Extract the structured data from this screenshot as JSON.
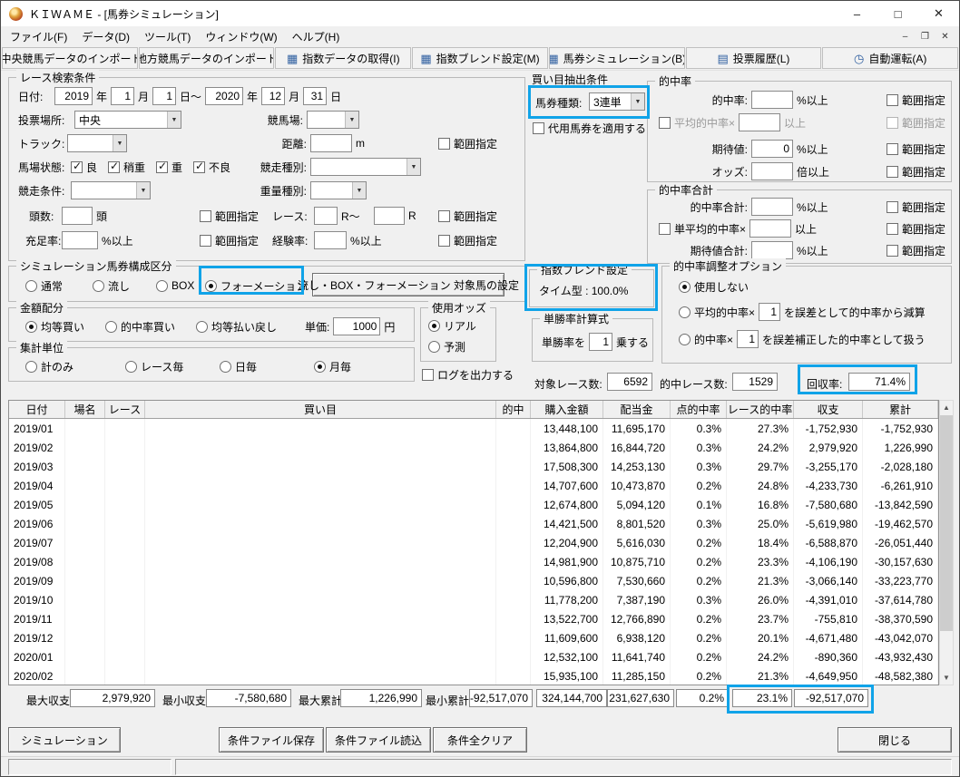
{
  "colors": {
    "accent": "#10a3e8"
  },
  "labels": {
    "range": "範囲指定"
  },
  "icons": {
    "minimize-icon": "–",
    "maximize-icon": "□",
    "close-icon": "✕",
    "mdi-minimize-icon": "–",
    "mdi-restore-icon": "❐",
    "mdi-close-icon": "✕",
    "dropdown-arrow-icon": "▼",
    "scroll-up-icon": "▲",
    "scroll-down-icon": "▼",
    "table-icon": "▦",
    "list-icon": "▤",
    "clock-icon": "◷"
  },
  "window": {
    "title": "ＫＩＷＡＭＥ - [馬券シミュレーション]",
    "controls": {
      "minimize": "–",
      "maximize": "□",
      "close": "✕"
    }
  },
  "menu": {
    "items": [
      "ファイル(F)",
      "データ(D)",
      "ツール(T)",
      "ウィンドウ(W)",
      "ヘルプ(H)"
    ]
  },
  "toolbar": {
    "buttons": [
      {
        "label": "中央競馬データのインポート(J)",
        "icon": "table-icon"
      },
      {
        "label": "地方競馬データのインポート(N)",
        "icon": "table-icon"
      },
      {
        "label": "指数データの取得(I)",
        "icon": "table-icon"
      },
      {
        "label": "指数ブレンド設定(M)",
        "icon": "table-icon"
      },
      {
        "label": "馬券シミュレーション(B)",
        "icon": "table-icon"
      },
      {
        "label": "投票履歴(L)",
        "icon": "list-icon"
      },
      {
        "label": "自動運転(A)",
        "icon": "clock-icon"
      }
    ]
  },
  "search": {
    "title": "レース検索条件",
    "date": {
      "label": "日付:",
      "y1": "2019",
      "u_year": "年",
      "m1": "1",
      "u_month": "月",
      "d1": "1",
      "u_day_to": "日～",
      "y2": "2020",
      "m2": "12",
      "d2": "31",
      "u_day": "日"
    },
    "place": {
      "label": "投票場所:",
      "value": "中央"
    },
    "course": {
      "label": "競馬場:",
      "value": ""
    },
    "track": {
      "label": "トラック:",
      "value": ""
    },
    "distance": {
      "label": "距離:",
      "value": "",
      "unit": "m"
    },
    "state": {
      "label": "馬場状態:",
      "options": [
        "良",
        "稍重",
        "重",
        "不良"
      ],
      "checked": [
        true,
        true,
        true,
        true
      ]
    },
    "race_kind": {
      "label": "競走種別:",
      "value": ""
    },
    "race_cond": {
      "label": "競走条件:",
      "value": ""
    },
    "weight_kind": {
      "label": "重量種別:",
      "value": ""
    },
    "heads": {
      "label": "頭数:",
      "value": "",
      "unit": "頭"
    },
    "race_no": {
      "label": "レース:",
      "v1": "",
      "sep": "R～",
      "v2": "",
      "unit": "R"
    },
    "fill_rate": {
      "label": "充足率:",
      "value": "",
      "unit": "%以上"
    },
    "exp_rate": {
      "label": "経験率:",
      "value": "",
      "unit": "%以上"
    }
  },
  "sim_type": {
    "title": "シミュレーション馬券構成区分",
    "options": [
      "通常",
      "流し",
      "BOX",
      "フォーメーション"
    ],
    "selected": "フォーメーション",
    "target_button": "流し・BOX・フォーメーション 対象馬の設定"
  },
  "amount": {
    "title": "金額配分",
    "options": [
      "均等買い",
      "的中率買い",
      "均等払い戻し"
    ],
    "selected": "均等買い",
    "unit_label": "単価:",
    "unit_value": "1000",
    "unit_suffix": "円"
  },
  "odds_used": {
    "title": "使用オッズ",
    "options": [
      "リアル",
      "予測"
    ],
    "selected": "リアル"
  },
  "aggregate": {
    "title": "集計単位",
    "options": [
      "計のみ",
      "レース毎",
      "日毎",
      "月毎"
    ],
    "selected": "月毎"
  },
  "log_label": "ログを出力する",
  "extract": {
    "title": "買い目抽出条件",
    "ticket": {
      "label": "馬券種類:",
      "value": "3連単"
    },
    "substitute": "代用馬券を適用する",
    "hit": {
      "title": "的中率",
      "rows": [
        {
          "label": "的中率:",
          "value": "",
          "unit": "%以上"
        },
        {
          "label": "平均的中率×",
          "value": "",
          "unit": "以上"
        },
        {
          "label": "期待値:",
          "value": "0",
          "unit": "%以上"
        },
        {
          "label": "オッズ:",
          "value": "",
          "unit": "倍以上"
        }
      ]
    },
    "hit_total": {
      "title": "的中率合計",
      "rows": [
        {
          "label": "的中率合計:",
          "value": "",
          "unit": "%以上"
        },
        {
          "label": "単平均的中率×",
          "value": "",
          "unit": "以上"
        },
        {
          "label": "期待値合計:",
          "value": "",
          "unit": "%以上"
        }
      ]
    }
  },
  "blend": {
    "title": "指数ブレンド設定",
    "value": "タイム型 : 100.0%"
  },
  "win_rate": {
    "title": "単勝率計算式",
    "prefix": "単勝率を",
    "value": "1",
    "suffix": "乗する"
  },
  "adjust": {
    "title": "的中率調整オプション",
    "opt1": "使用しない",
    "opt2_pre": "平均的中率×",
    "opt2_val": "1",
    "opt2_post": "を誤差として的中率から減算",
    "opt3_pre": "的中率×",
    "opt3_val": "1",
    "opt3_post": "を誤差補正した的中率として扱う",
    "selected": "使用しない"
  },
  "stats": {
    "target_label": "対象レース数:",
    "target_value": "6592",
    "hit_label": "的中レース数:",
    "hit_value": "1529",
    "payback_label": "回収率:",
    "payback_value": "71.4%"
  },
  "table": {
    "columns": [
      "日付",
      "場名",
      "レース",
      "買い目",
      "的中",
      "購入金額",
      "配当金",
      "点的中率",
      "レース的中率",
      "収支",
      "累計"
    ],
    "rows": [
      [
        "2019/01",
        "",
        "",
        "",
        "",
        "13,448,100",
        "11,695,170",
        "0.3%",
        "27.3%",
        "-1,752,930",
        "-1,752,930"
      ],
      [
        "2019/02",
        "",
        "",
        "",
        "",
        "13,864,800",
        "16,844,720",
        "0.3%",
        "24.2%",
        "2,979,920",
        "1,226,990"
      ],
      [
        "2019/03",
        "",
        "",
        "",
        "",
        "17,508,300",
        "14,253,130",
        "0.3%",
        "29.7%",
        "-3,255,170",
        "-2,028,180"
      ],
      [
        "2019/04",
        "",
        "",
        "",
        "",
        "14,707,600",
        "10,473,870",
        "0.2%",
        "24.8%",
        "-4,233,730",
        "-6,261,910"
      ],
      [
        "2019/05",
        "",
        "",
        "",
        "",
        "12,674,800",
        "5,094,120",
        "0.1%",
        "16.8%",
        "-7,580,680",
        "-13,842,590"
      ],
      [
        "2019/06",
        "",
        "",
        "",
        "",
        "14,421,500",
        "8,801,520",
        "0.3%",
        "25.0%",
        "-5,619,980",
        "-19,462,570"
      ],
      [
        "2019/07",
        "",
        "",
        "",
        "",
        "12,204,900",
        "5,616,030",
        "0.2%",
        "18.4%",
        "-6,588,870",
        "-26,051,440"
      ],
      [
        "2019/08",
        "",
        "",
        "",
        "",
        "14,981,900",
        "10,875,710",
        "0.2%",
        "23.3%",
        "-4,106,190",
        "-30,157,630"
      ],
      [
        "2019/09",
        "",
        "",
        "",
        "",
        "10,596,800",
        "7,530,660",
        "0.2%",
        "21.3%",
        "-3,066,140",
        "-33,223,770"
      ],
      [
        "2019/10",
        "",
        "",
        "",
        "",
        "11,778,200",
        "7,387,190",
        "0.3%",
        "26.0%",
        "-4,391,010",
        "-37,614,780"
      ],
      [
        "2019/11",
        "",
        "",
        "",
        "",
        "13,522,700",
        "12,766,890",
        "0.2%",
        "23.7%",
        "-755,810",
        "-38,370,590"
      ],
      [
        "2019/12",
        "",
        "",
        "",
        "",
        "11,609,600",
        "6,938,120",
        "0.2%",
        "20.1%",
        "-4,671,480",
        "-43,042,070"
      ],
      [
        "2020/01",
        "",
        "",
        "",
        "",
        "12,532,100",
        "11,641,740",
        "0.2%",
        "24.2%",
        "-890,360",
        "-43,932,430"
      ],
      [
        "2020/02",
        "",
        "",
        "",
        "",
        "15,935,100",
        "11,285,150",
        "0.2%",
        "21.3%",
        "-4,649,950",
        "-48,582,380"
      ]
    ]
  },
  "footer": {
    "max_balance_label": "最大収支:",
    "max_balance": "2,979,920",
    "min_balance_label": "最小収支:",
    "min_balance": "-7,580,680",
    "max_cum_label": "最大累計:",
    "max_cum": "1,226,990",
    "min_cum_label": "最小累計:",
    "min_cum": "-92,517,070",
    "total_purchase": "324,144,700",
    "total_payout": "231,627,630",
    "total_point_rate": "0.2%",
    "total_race_rate": "23.1%",
    "total_balance": "-92,517,070"
  },
  "actions": {
    "simulate": "シミュレーション",
    "save": "条件ファイル保存",
    "load": "条件ファイル読込",
    "clear": "条件全クリア",
    "close": "閉じる"
  }
}
